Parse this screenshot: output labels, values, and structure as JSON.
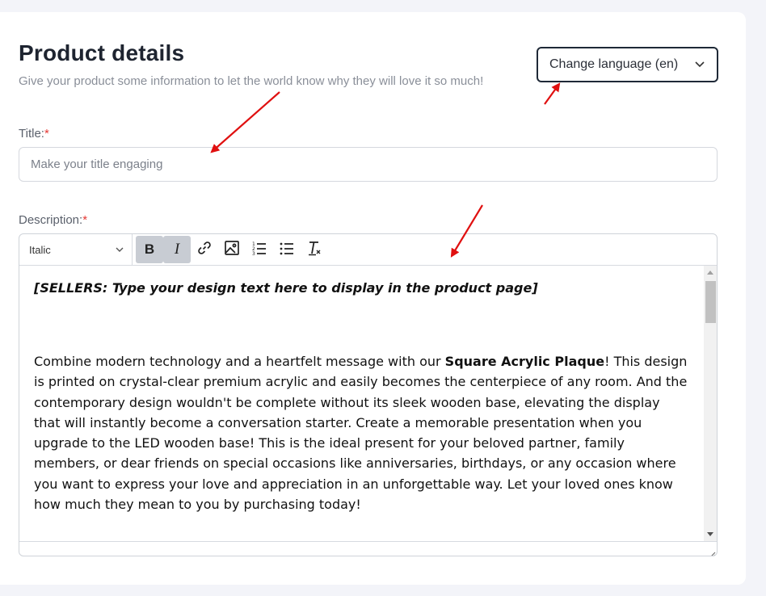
{
  "header": {
    "title": "Product details",
    "subtitle": "Give your product some information to let the world know why they will love it so much!"
  },
  "language_button": {
    "label": "Change language (en)",
    "icon": "chevron-down-icon"
  },
  "title_field": {
    "label": "Title:",
    "required_mark": "*",
    "placeholder": "Make your title engaging",
    "value": ""
  },
  "description_field": {
    "label": "Description:",
    "required_mark": "*"
  },
  "editor": {
    "format_select_value": "Italic",
    "toolbar": {
      "bold_label": "B",
      "italic_label": "I",
      "icons": [
        "link-icon",
        "image-icon",
        "ordered-list-icon",
        "bullet-list-icon",
        "clear-format-icon"
      ]
    },
    "content": {
      "design_line": "[SELLERS: Type your design text here to display in the product page]",
      "para_before": "Combine modern technology and a heartfelt message with our ",
      "para_bold": "Square Acrylic Plaque",
      "para_after": "! This design is printed on crystal-clear premium acrylic and easily becomes the centerpiece of any room. And the contemporary design wouldn't be complete without its sleek wooden base, elevating the display that will instantly become a conversation starter. Create a memorable presentation when you upgrade to the LED wooden base! This is the ideal present for your beloved partner, family members, or dear friends on special occasions like anniversaries, birthdays, or any occasion where you want to express your love and appreciation in an unforgettable way. Let your loved ones know how much they mean to you by purchasing today!"
    }
  },
  "colors": {
    "required": "#e53935",
    "annotation_arrow": "#e01010",
    "active_button": "#c8ccd3"
  }
}
